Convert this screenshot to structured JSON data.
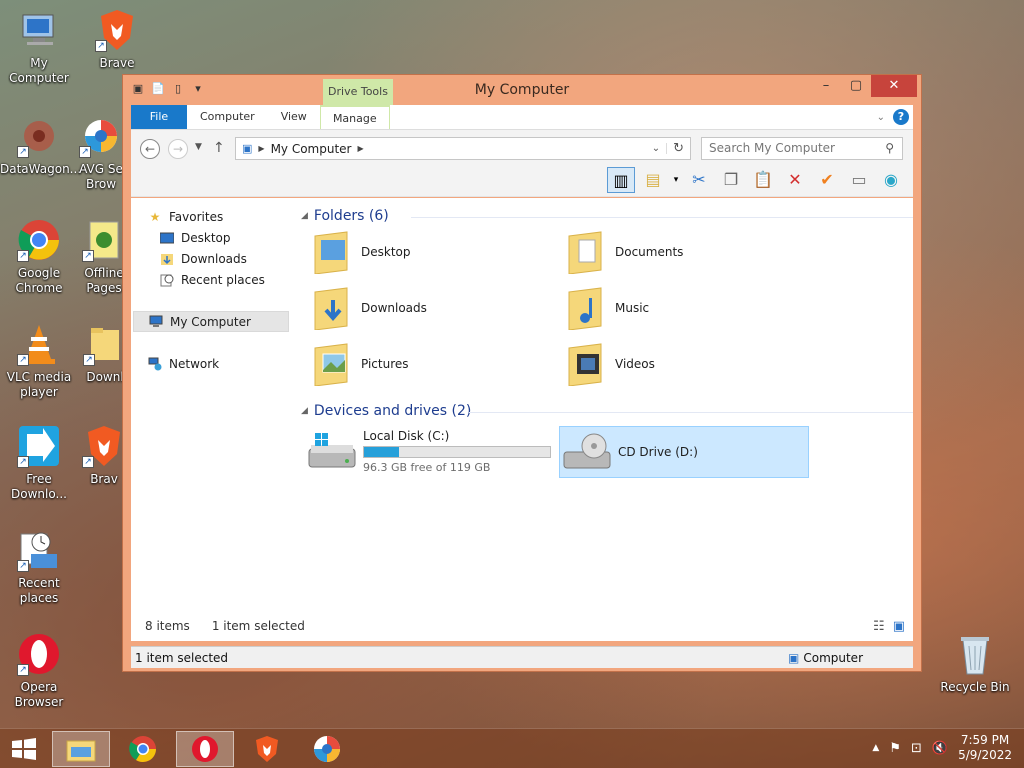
{
  "desktop": {
    "icons": [
      {
        "label": "My Computer",
        "icon": "computer-icon"
      },
      {
        "label": "Brave",
        "icon": "brave-lion-icon"
      },
      {
        "label": "DataWagon...",
        "icon": "gear-icon"
      },
      {
        "label": "AVG Se Brow",
        "icon": "avg-browser-icon"
      },
      {
        "label": "Google Chrome",
        "icon": "chrome-icon"
      },
      {
        "label": "Offline Pages",
        "icon": "offline-pages-icon"
      },
      {
        "label": "VLC media player",
        "icon": "vlc-cone-icon"
      },
      {
        "label": "Downl",
        "icon": "folder-icon"
      },
      {
        "label": "Free Downlo...",
        "icon": "download-arrow-icon"
      },
      {
        "label": "Brav",
        "icon": "brave-lion-icon"
      },
      {
        "label": "Recent places",
        "icon": "recent-places-icon"
      },
      {
        "label": "Opera Browser",
        "icon": "opera-icon"
      },
      {
        "label": "Recycle Bin",
        "icon": "recycle-bin-icon"
      }
    ]
  },
  "window": {
    "title": "My Computer",
    "contextual_tab_group": "Drive Tools",
    "tabs": [
      "File",
      "Computer",
      "View",
      "Manage"
    ],
    "address": {
      "location": "My Computer"
    },
    "search": {
      "placeholder": "Search My Computer"
    },
    "nav": {
      "favorites": "Favorites",
      "desktop": "Desktop",
      "downloads": "Downloads",
      "recent": "Recent places",
      "my_computer": "My Computer",
      "network": "Network"
    },
    "groups": {
      "folders": "Folders (6)",
      "devices": "Devices and drives (2)"
    },
    "folders": [
      "Desktop",
      "Documents",
      "Downloads",
      "Music",
      "Pictures",
      "Videos"
    ],
    "drives": {
      "local": {
        "name": "Local Disk (C:)",
        "free_text": "96.3 GB free of 119 GB",
        "used_fraction": 0.19
      },
      "cd": {
        "name": "CD Drive (D:)"
      }
    },
    "status": {
      "items": "8 items",
      "selected": "1 item selected",
      "bottom_left": "1 item selected",
      "bottom_right": "Computer"
    }
  },
  "taskbar": {
    "clock_time": "7:59 PM",
    "clock_date": "5/9/2022"
  }
}
